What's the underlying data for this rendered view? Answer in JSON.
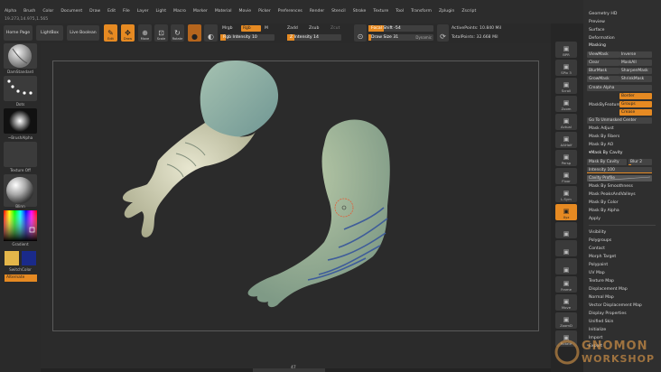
{
  "menu": {
    "items": [
      "Alpha",
      "Brush",
      "Color",
      "Document",
      "Draw",
      "Edit",
      "File",
      "Layer",
      "Light",
      "Macro",
      "Marker",
      "Material",
      "Movie",
      "Picker",
      "Preferences",
      "Render",
      "Stencil",
      "Stroke",
      "Texture",
      "Tool",
      "Transform",
      "Zplugin",
      "Zscript"
    ],
    "coords": "19.273,14.975,1.565"
  },
  "toolbar": {
    "home": "Home Page",
    "lightbox": "LightBox",
    "live_boolean": "Live Boolean",
    "edit": "Edit",
    "draw": "Draw",
    "move": "Move",
    "scale": "Scale",
    "rotate": "Rotate",
    "mrgb": "Mrgb",
    "rgb": "Rgb",
    "m": "M",
    "rgb_intensity": "Rgb Intensity 10",
    "rgb_intensity_value": 0.1,
    "zadd": "Zadd",
    "zsub": "Zsub",
    "zcut": "Zcut",
    "z_intensity": "Z Intensity 14",
    "z_intensity_value": 0.14,
    "focal_shift": "Focal Shift -54",
    "draw_size": "Draw Size 31",
    "dynamic": "Dynamic",
    "active_points": "ActivePoints: 10.840 Mil",
    "total_points": "TotalPoints: 32.668 Mil"
  },
  "leftshelf": {
    "brush": "DamStandard",
    "stroke": "Dots",
    "alpha": "~BrushAlpha",
    "texture": "Texture Off",
    "material": "Blinn",
    "gradient": "Gradient",
    "switch_color": "SwitchColor",
    "alternate": "Alternate",
    "main_color": "#e4b64a",
    "secondary_color": "#1a2a8a"
  },
  "rightstrip": {
    "items": [
      "BPR",
      "SPix 3",
      "Scroll",
      "Zoom",
      "Actual",
      "AAHalf",
      "Persp",
      "Floor",
      "L.Sym",
      "Xyz",
      "",
      "",
      "",
      "Frame",
      "Move",
      "ZoomD",
      "Rotate",
      "Line Fill PolyF",
      "",
      "Transp",
      "Solo"
    ]
  },
  "palette": {
    "top_items": [
      "Geometry HD",
      "Preview",
      "Surface",
      "Deformation"
    ],
    "masking_title": "Masking",
    "view_mask": "ViewMask",
    "inverse": "Inverse",
    "clear": "Clear",
    "mask_all": "MaskAll",
    "blur_mask": "BlurMask",
    "sharpen_mask": "SharpenMask",
    "grow_mask": "GrowMask",
    "shrink_mask": "ShrinkMask",
    "create_alpha": "Create Alpha",
    "mask_by_feature": "MaskByFeature",
    "border": "Border",
    "groups": "Groups",
    "crease": "Crease",
    "go_to_unmasked": "Go To Unmasked Center",
    "mask_adjust": "Mask Adjust",
    "mask_by_fibers": "Mask By Fibers",
    "mask_by_ao": "Mask By AO",
    "mask_by_cavity_title": "Mask By Cavity",
    "mask_by_cavity": "Mask By Cavity",
    "blur": "Blur 2",
    "intensity": "Intensity 100",
    "cavity_profile": "Cavity Profile",
    "mask_by_smoothness": "Mask By Smoothness",
    "mask_peaks": "Mask PeaksAndValleys",
    "mask_by_color": "Mask By Color",
    "mask_by_alpha": "Mask By Alpha",
    "apply": "Apply",
    "bottom_items": [
      "Visibility",
      "Polygroups",
      "Contact",
      "Morph Target",
      "Polypaint",
      "UV Map",
      "Texture Map",
      "Displacement Map",
      "Normal Map",
      "Vector Displacement Map",
      "Display Properties",
      "Unified Skin",
      "Initialize",
      "Import",
      "Export"
    ]
  },
  "watermark": {
    "line1": "GNOMON",
    "line2": "WORKSHOP"
  },
  "canvas_footer": "47"
}
